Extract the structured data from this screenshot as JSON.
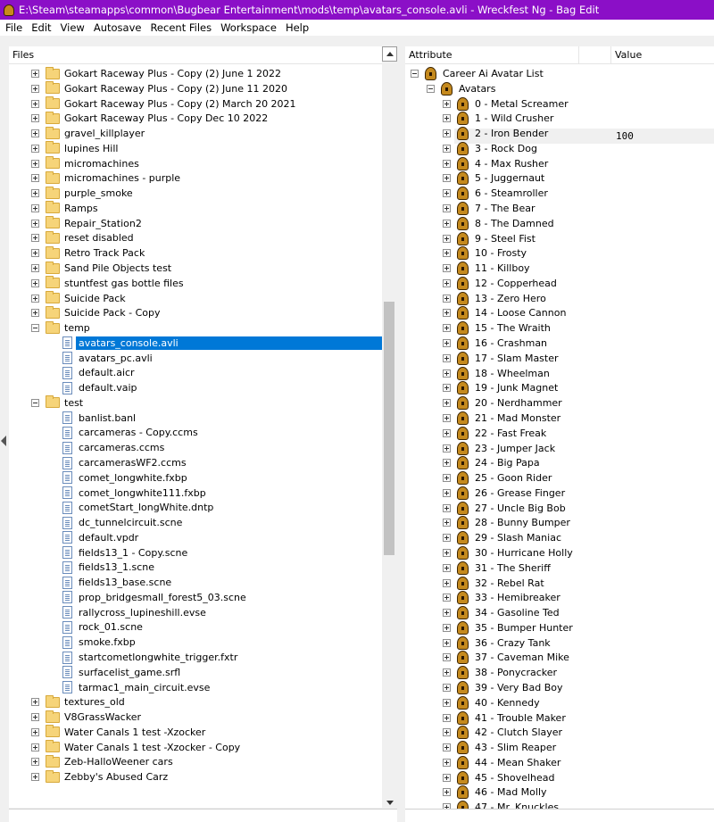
{
  "window": {
    "title": "E:\\Steam\\steamapps\\common\\Bugbear Entertainment\\mods\\temp\\avatars_console.avli - Wreckfest Ng - Bag Edit",
    "title_icon": "bag-icon"
  },
  "menu": [
    "File",
    "Edit",
    "View",
    "Autosave",
    "Recent Files",
    "Workspace",
    "Help"
  ],
  "files_pane": {
    "header": "Files",
    "rows": [
      {
        "label": "Gokart Raceway Plus - Copy (2) June 1 2022",
        "type": "folder",
        "depth": 0,
        "state": "collapsed"
      },
      {
        "label": "Gokart Raceway Plus - Copy (2) June 11 2020",
        "type": "folder",
        "depth": 0,
        "state": "collapsed"
      },
      {
        "label": "Gokart Raceway Plus - Copy (2) March 20 2021",
        "type": "folder",
        "depth": 0,
        "state": "collapsed"
      },
      {
        "label": "Gokart Raceway Plus - Copy Dec 10 2022",
        "type": "folder",
        "depth": 0,
        "state": "collapsed"
      },
      {
        "label": "gravel_killplayer",
        "type": "folder",
        "depth": 0,
        "state": "collapsed"
      },
      {
        "label": "lupines Hill",
        "type": "folder",
        "depth": 0,
        "state": "collapsed"
      },
      {
        "label": "micromachines",
        "type": "folder",
        "depth": 0,
        "state": "collapsed"
      },
      {
        "label": "micromachines - purple",
        "type": "folder",
        "depth": 0,
        "state": "collapsed"
      },
      {
        "label": "purple_smoke",
        "type": "folder",
        "depth": 0,
        "state": "collapsed"
      },
      {
        "label": "Ramps",
        "type": "folder",
        "depth": 0,
        "state": "collapsed"
      },
      {
        "label": "Repair_Station2",
        "type": "folder",
        "depth": 0,
        "state": "collapsed"
      },
      {
        "label": "reset disabled",
        "type": "folder",
        "depth": 0,
        "state": "collapsed"
      },
      {
        "label": "Retro Track Pack",
        "type": "folder",
        "depth": 0,
        "state": "collapsed"
      },
      {
        "label": "Sand Pile Objects test",
        "type": "folder",
        "depth": 0,
        "state": "collapsed"
      },
      {
        "label": "stuntfest gas bottle files",
        "type": "folder",
        "depth": 0,
        "state": "collapsed"
      },
      {
        "label": "Suicide Pack",
        "type": "folder",
        "depth": 0,
        "state": "collapsed"
      },
      {
        "label": "Suicide Pack - Copy",
        "type": "folder",
        "depth": 0,
        "state": "collapsed"
      },
      {
        "label": "temp",
        "type": "folder",
        "depth": 0,
        "state": "expanded"
      },
      {
        "label": "avatars_console.avli",
        "type": "file",
        "depth": 1,
        "selected": true
      },
      {
        "label": "avatars_pc.avli",
        "type": "file",
        "depth": 1
      },
      {
        "label": "default.aicr",
        "type": "file",
        "depth": 1
      },
      {
        "label": "default.vaip",
        "type": "file",
        "depth": 1
      },
      {
        "label": "test",
        "type": "folder",
        "depth": 0,
        "state": "expanded"
      },
      {
        "label": "banlist.banl",
        "type": "file",
        "depth": 1
      },
      {
        "label": "carcameras - Copy.ccms",
        "type": "file",
        "depth": 1
      },
      {
        "label": "carcameras.ccms",
        "type": "file",
        "depth": 1
      },
      {
        "label": "carcamerasWF2.ccms",
        "type": "file",
        "depth": 1
      },
      {
        "label": "comet_longwhite.fxbp",
        "type": "file",
        "depth": 1
      },
      {
        "label": "comet_longwhite111.fxbp",
        "type": "file",
        "depth": 1
      },
      {
        "label": "cometStart_longWhite.dntp",
        "type": "file",
        "depth": 1
      },
      {
        "label": "dc_tunnelcircuit.scne",
        "type": "file",
        "depth": 1
      },
      {
        "label": "default.vpdr",
        "type": "file",
        "depth": 1
      },
      {
        "label": "fields13_1 - Copy.scne",
        "type": "file",
        "depth": 1
      },
      {
        "label": "fields13_1.scne",
        "type": "file",
        "depth": 1
      },
      {
        "label": "fields13_base.scne",
        "type": "file",
        "depth": 1
      },
      {
        "label": "prop_bridgesmall_forest5_03.scne",
        "type": "file",
        "depth": 1
      },
      {
        "label": "rallycross_lupineshill.evse",
        "type": "file",
        "depth": 1
      },
      {
        "label": "rock_01.scne",
        "type": "file",
        "depth": 1
      },
      {
        "label": "smoke.fxbp",
        "type": "file",
        "depth": 1
      },
      {
        "label": "startcometlongwhite_trigger.fxtr",
        "type": "file",
        "depth": 1
      },
      {
        "label": "surfacelist_game.srfl",
        "type": "file",
        "depth": 1
      },
      {
        "label": "tarmac1_main_circuit.evse",
        "type": "file",
        "depth": 1
      },
      {
        "label": "textures_old",
        "type": "folder",
        "depth": 0,
        "state": "collapsed"
      },
      {
        "label": "V8GrassWacker",
        "type": "folder",
        "depth": 0,
        "state": "collapsed"
      },
      {
        "label": "Water Canals 1 test -Xzocker",
        "type": "folder",
        "depth": 0,
        "state": "collapsed"
      },
      {
        "label": "Water Canals 1 test -Xzocker - Copy",
        "type": "folder",
        "depth": 0,
        "state": "collapsed"
      },
      {
        "label": "Zeb-HalloWeener cars",
        "type": "folder",
        "depth": 0,
        "state": "collapsed"
      },
      {
        "label": "Zebby's Abused Carz",
        "type": "folder",
        "depth": 0,
        "state": "collapsed"
      }
    ]
  },
  "attributes_pane": {
    "columns": {
      "attribute": "Attribute",
      "value": "Value"
    },
    "root": "Career Ai Avatar List",
    "group": {
      "label": "Avatars",
      "value": "100"
    },
    "items": [
      "0 - Metal Screamer",
      "1 - Wild Crusher",
      "2 - Iron Bender",
      "3 - Rock Dog",
      "4 - Max Rusher",
      "5 - Juggernaut",
      "6 - Steamroller",
      "7 - The Bear",
      "8 - The Damned",
      "9 - Steel Fist",
      "10 - Frosty",
      "11 - Killboy",
      "12 - Copperhead",
      "13 - Zero Hero",
      "14 - Loose Cannon",
      "15 - The Wraith",
      "16 - Crashman",
      "17 - Slam Master",
      "18 - Wheelman",
      "19 - Junk Magnet",
      "20 - Nerdhammer",
      "21 - Mad Monster",
      "22 - Fast Freak",
      "23 - Jumper Jack",
      "24 - Big Papa",
      "25 - Goon Rider",
      "26 - Grease Finger",
      "27 - Uncle Big Bob",
      "28 - Bunny Bumper",
      "29 - Slash Maniac",
      "30 - Hurricane Holly",
      "31 - The Sheriff",
      "32 - Rebel Rat",
      "33 - Hemibreaker",
      "34 - Gasoline Ted",
      "35 - Bumper Hunter",
      "36 - Crazy Tank",
      "37 - Caveman Mike",
      "38 - Ponycracker",
      "39 - Very Bad Boy",
      "40 - Kennedy",
      "41 - Trouble Maker",
      "42 - Clutch Slayer",
      "43 - Slim Reaper",
      "44 - Mean Shaker",
      "45 - Shovelhead",
      "46 - Mad Molly",
      "47 - Mr. Knuckles"
    ]
  },
  "colors": {
    "titlebar": "#8b0fc7",
    "selection": "#0078d7",
    "folder": "#f6d479"
  }
}
